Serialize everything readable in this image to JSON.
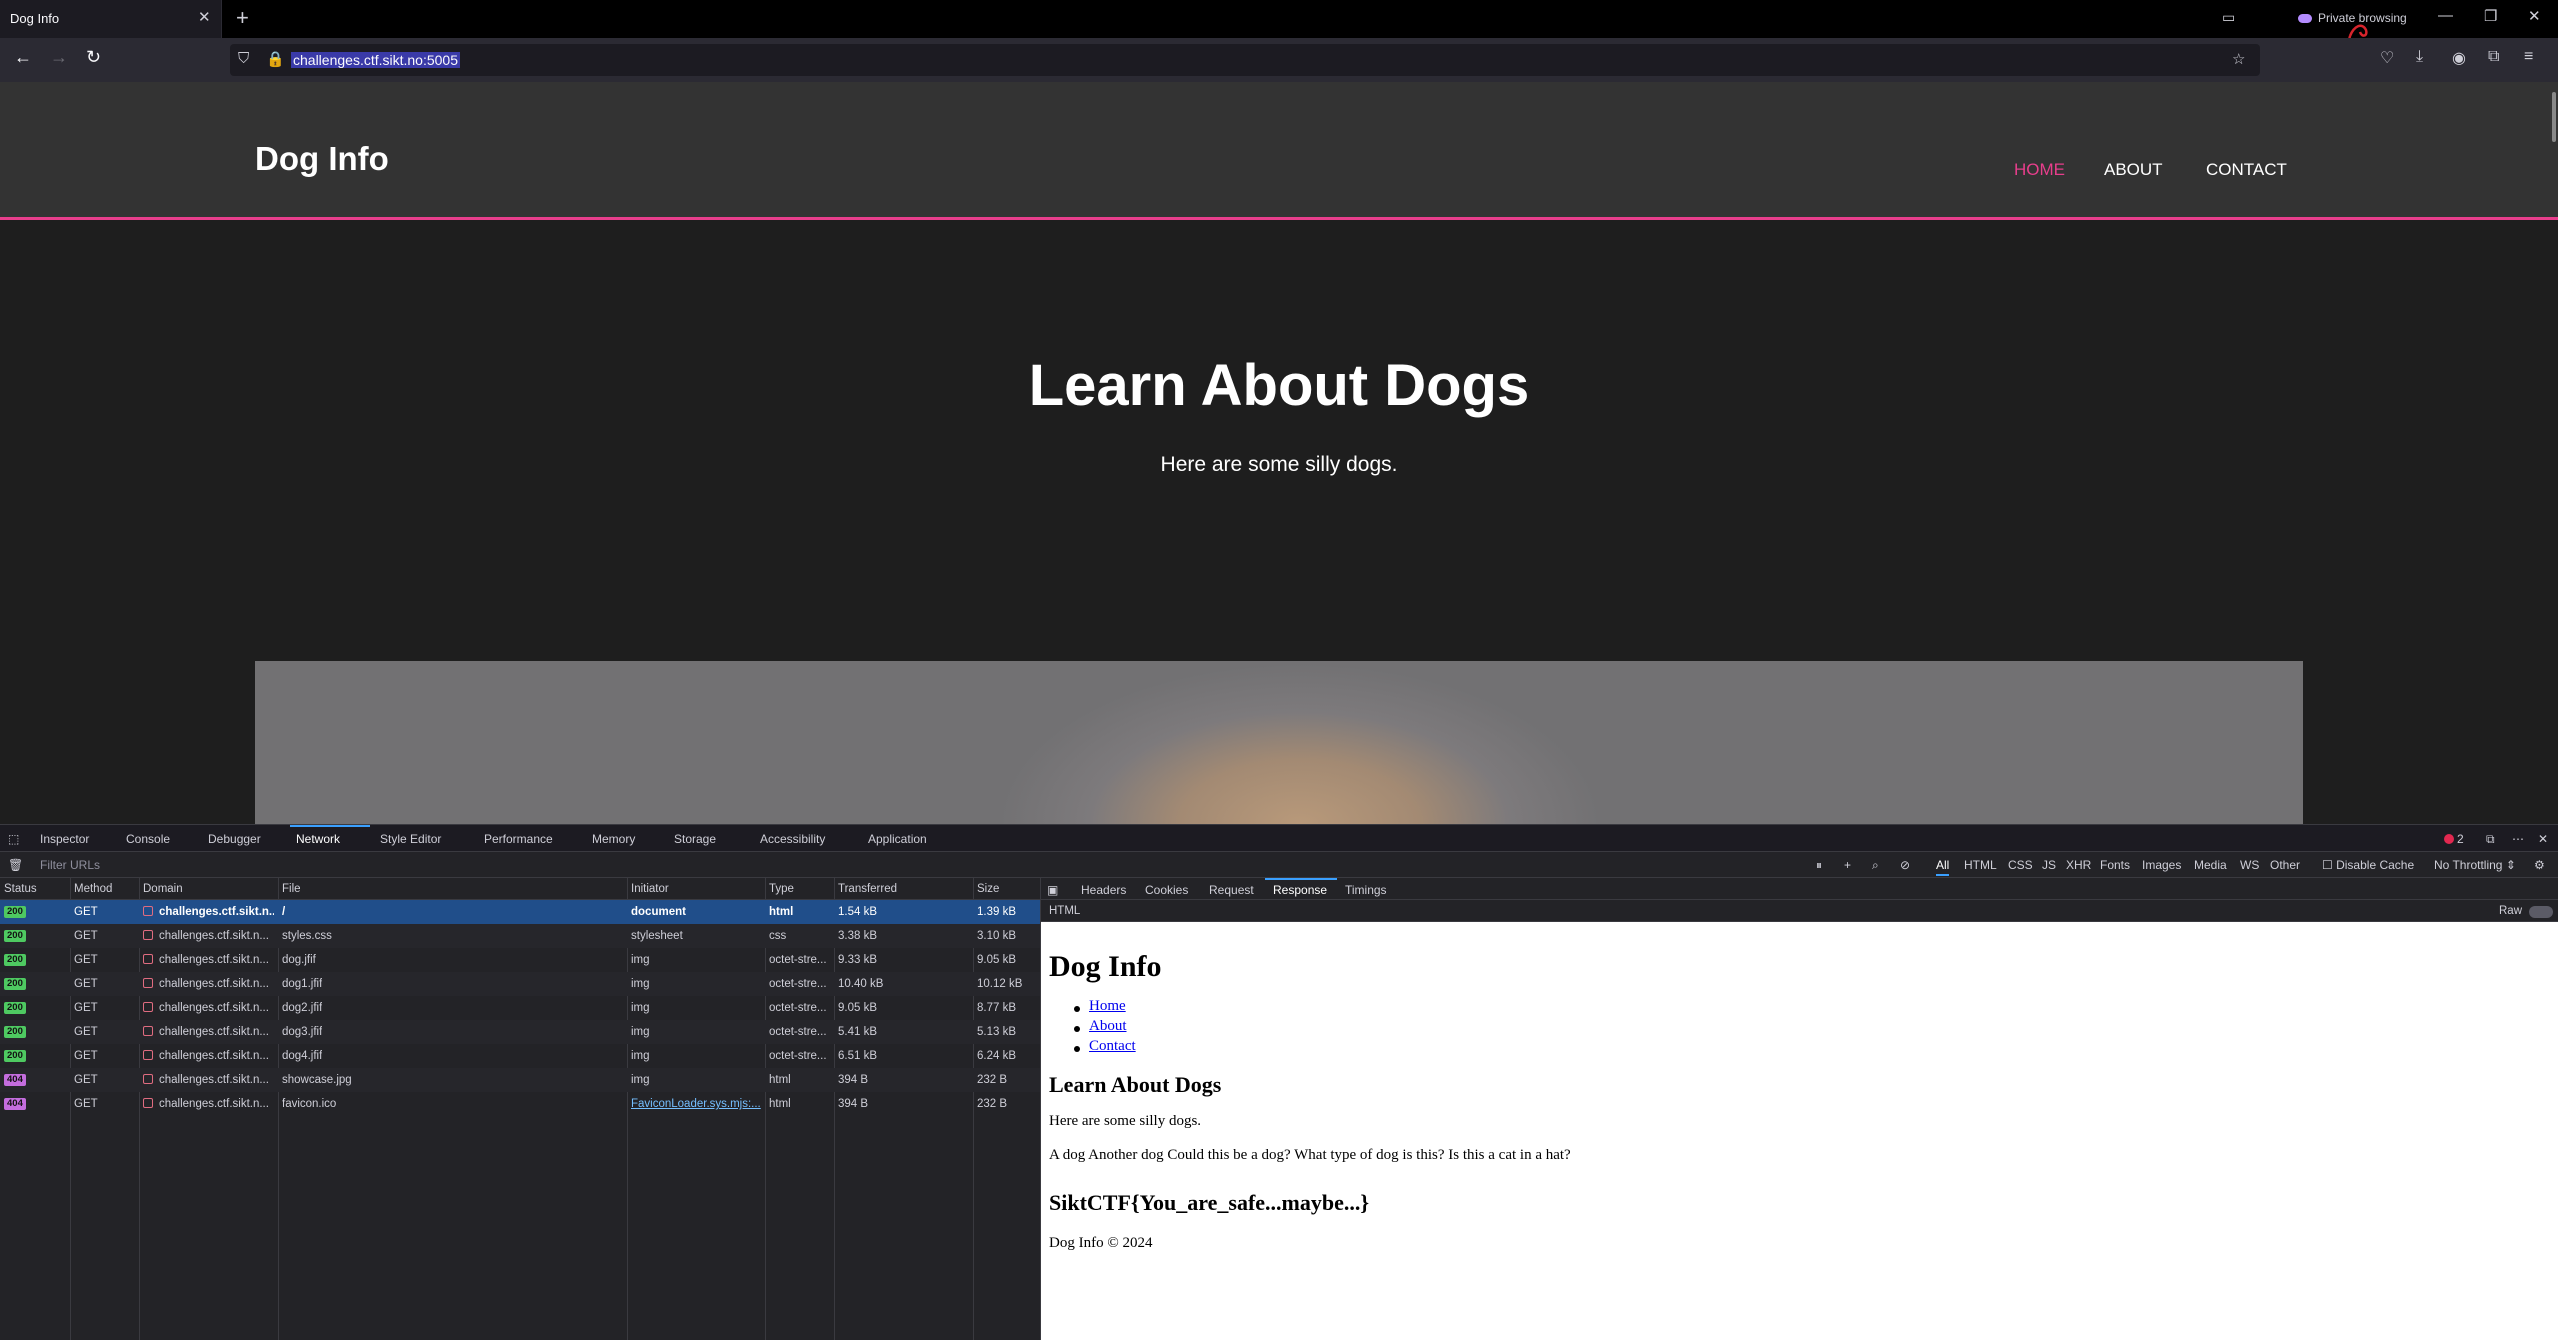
{
  "browser": {
    "tab_title": "Dog Info",
    "url": "challenges.ctf.sikt.no:5005",
    "private_label": "Private browsing"
  },
  "site": {
    "title": "Dog Info",
    "nav": [
      "HOME",
      "ABOUT",
      "CONTACT"
    ],
    "hero_title": "Learn About Dogs",
    "hero_subtitle": "Here are some silly dogs.",
    "accent_color": "#e83e8c"
  },
  "devtools": {
    "tabs": [
      "Inspector",
      "Console",
      "Debugger",
      "Network",
      "Style Editor",
      "Performance",
      "Memory",
      "Storage",
      "Accessibility",
      "Application"
    ],
    "error_count": "2",
    "filter_placeholder": "Filter URLs",
    "type_filters": [
      "All",
      "HTML",
      "CSS",
      "JS",
      "XHR",
      "Fonts",
      "Images",
      "Media",
      "WS",
      "Other"
    ],
    "disable_cache": "Disable Cache",
    "throttling": "No Throttling ⇕",
    "columns": [
      "Status",
      "Method",
      "Domain",
      "File",
      "Initiator",
      "Type",
      "Transferred",
      "Size"
    ],
    "requests": [
      {
        "status": "200",
        "method": "GET",
        "domain": "challenges.ctf.sikt.n...",
        "file": "/",
        "initiator": "document",
        "type": "html",
        "transferred": "1.54 kB",
        "size": "1.39 kB"
      },
      {
        "status": "200",
        "method": "GET",
        "domain": "challenges.ctf.sikt.n...",
        "file": "styles.css",
        "initiator": "stylesheet",
        "type": "css",
        "transferred": "3.38 kB",
        "size": "3.10 kB"
      },
      {
        "status": "200",
        "method": "GET",
        "domain": "challenges.ctf.sikt.n...",
        "file": "dog.jfif",
        "initiator": "img",
        "type": "octet-stre...",
        "transferred": "9.33 kB",
        "size": "9.05 kB"
      },
      {
        "status": "200",
        "method": "GET",
        "domain": "challenges.ctf.sikt.n...",
        "file": "dog1.jfif",
        "initiator": "img",
        "type": "octet-stre...",
        "transferred": "10.40 kB",
        "size": "10.12 kB"
      },
      {
        "status": "200",
        "method": "GET",
        "domain": "challenges.ctf.sikt.n...",
        "file": "dog2.jfif",
        "initiator": "img",
        "type": "octet-stre...",
        "transferred": "9.05 kB",
        "size": "8.77 kB"
      },
      {
        "status": "200",
        "method": "GET",
        "domain": "challenges.ctf.sikt.n...",
        "file": "dog3.jfif",
        "initiator": "img",
        "type": "octet-stre...",
        "transferred": "5.41 kB",
        "size": "5.13 kB"
      },
      {
        "status": "200",
        "method": "GET",
        "domain": "challenges.ctf.sikt.n...",
        "file": "dog4.jfif",
        "initiator": "img",
        "type": "octet-stre...",
        "transferred": "6.51 kB",
        "size": "6.24 kB"
      },
      {
        "status": "404",
        "method": "GET",
        "domain": "challenges.ctf.sikt.n...",
        "file": "showcase.jpg",
        "initiator": "img",
        "type": "html",
        "transferred": "394 B",
        "size": "232 B"
      },
      {
        "status": "404",
        "method": "GET",
        "domain": "challenges.ctf.sikt.n...",
        "file": "favicon.ico",
        "initiator": "FaviconLoader.sys.mjs:...",
        "type": "html",
        "transferred": "394 B",
        "size": "232 B"
      }
    ],
    "detail_tabs": [
      "Headers",
      "Cookies",
      "Request",
      "Response",
      "Timings"
    ],
    "detail_sub_label": "HTML",
    "raw_label": "Raw",
    "preview": {
      "h1": "Dog Info",
      "links": [
        "Home",
        "About",
        "Contact"
      ],
      "h2": "Learn About Dogs",
      "p1": "Here are some silly dogs.",
      "p2": "A dog Another dog Could this be a dog? What type of dog is this? Is this a cat in a hat?",
      "flag": "SiktCTF{You_are_safe...maybe...}",
      "footer": "Dog Info © 2024"
    }
  }
}
